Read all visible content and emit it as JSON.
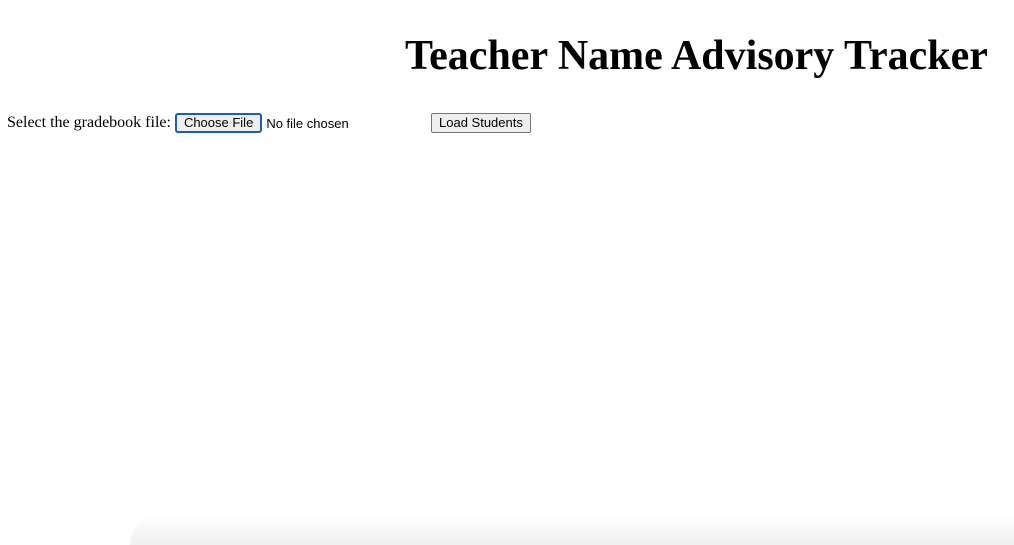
{
  "header": {
    "title": "Teacher Name Advisory Tracker"
  },
  "file_picker": {
    "label": "Select the gradebook file:",
    "button_label": "Choose File",
    "status": "No file chosen"
  },
  "actions": {
    "load_label": "Load Students"
  }
}
